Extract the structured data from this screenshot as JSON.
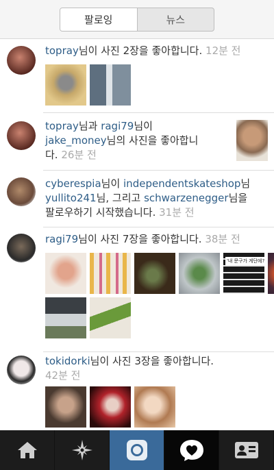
{
  "tabs": {
    "following": "팔로잉",
    "news": "뉴스"
  },
  "feed": [
    {
      "user1": "topray",
      "text1": "님이 사진 2장을 좋아합니다.",
      "time": "12분 전"
    },
    {
      "user1": "topray",
      "and": "님과 ",
      "user2": "ragi79",
      "mid": "님이",
      "user3": "jake_money",
      "rest_a": "님의 사진을 좋아합니",
      "rest_b": "다.",
      "time": "26분 전"
    },
    {
      "user1": "cyberespia",
      "mid1": "님이 ",
      "user2": "independentskateshop",
      "tail1": "님",
      "user3": "yullito241",
      "mid2": "님, 그리고 ",
      "user4": "schwarzenegger",
      "tail2": "님을",
      "rest": "팔로우하기 시작했습니다.",
      "time": "31분 전"
    },
    {
      "user1": "ragi79",
      "text1": "님이 사진 7장을 좋아합니다.",
      "time": "38분 전",
      "photo_caption": "'내 문구가 게단에?'"
    },
    {
      "user1": "tokidorki",
      "text1": "님이 사진 3장을 좋아합니다.",
      "time": "42분 전"
    }
  ],
  "tabbar_icons": [
    "home-icon",
    "explore-icon",
    "camera-icon",
    "activity-heart-icon",
    "profile-icon"
  ]
}
